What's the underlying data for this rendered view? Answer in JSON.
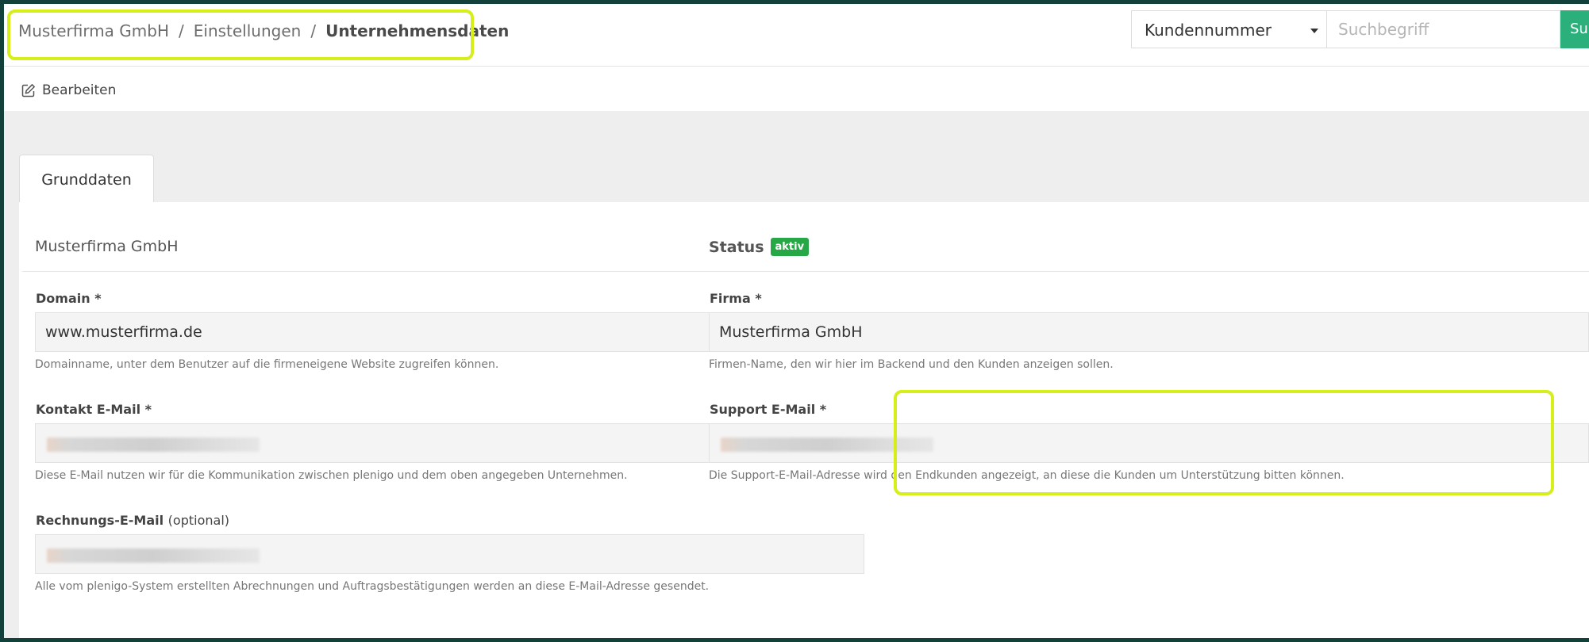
{
  "breadcrumb": {
    "items": [
      "Musterfirma GmbH",
      "Einstellungen"
    ],
    "separator": "/",
    "current": "Unternehmensdaten"
  },
  "search": {
    "select_value": "Kundennummer",
    "placeholder": "Suchbegriff",
    "button_label": "Su"
  },
  "toolbar": {
    "edit_label": "Bearbeiten"
  },
  "tabs": [
    {
      "label": "Grunddaten",
      "active": true
    }
  ],
  "panel": {
    "company_name": "Musterfirma GmbH",
    "status_label": "Status",
    "status_badge": "aktiv",
    "left": {
      "domain": {
        "label": "Domain",
        "required": "*",
        "value": "www.musterfirma.de",
        "help": "Domainname, unter dem Benutzer auf die firmeneigene Website zugreifen können."
      },
      "contact_email": {
        "label": "Kontakt E-Mail",
        "required": "*",
        "help": "Diese E-Mail nutzen wir für die Kommunikation zwischen plenigo und dem oben angegeben Unternehmen."
      },
      "billing_email": {
        "label": "Rechnungs-E-Mail",
        "optional": "(optional)",
        "help": "Alle vom plenigo-System erstellten Abrechnungen und Auftragsbestätigungen werden an diese E-Mail-Adresse gesendet."
      }
    },
    "right": {
      "company": {
        "label": "Firma",
        "required": "*",
        "value": "Musterfirma GmbH",
        "help": "Firmen-Name, den wir hier im Backend und den Kunden anzeigen sollen."
      },
      "support_email": {
        "label": "Support E-Mail",
        "required": "*",
        "help": "Die Support-E-Mail-Adresse wird den Endkunden angezeigt, an diese die Kunden um Unterstützung bitten können."
      }
    }
  },
  "colors": {
    "highlight": "#d6ee1a",
    "status_green": "#27a745",
    "search_button": "#2bb07b",
    "frame": "#12403a"
  }
}
